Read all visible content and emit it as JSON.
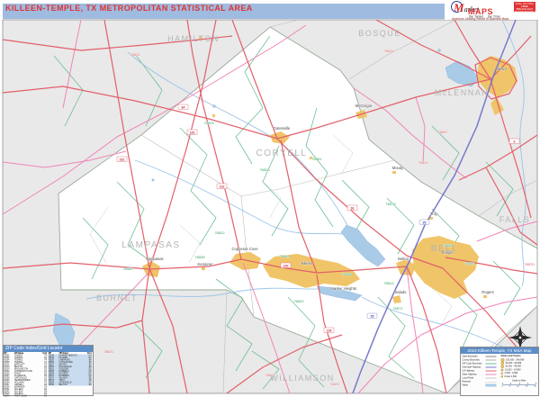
{
  "window": {
    "title": "KILLEEN-TEMPLE, TX METROPOLITAN STATISTICAL AREA"
  },
  "logo": {
    "m": "M",
    "rest": "arket",
    "maps": "MAPS",
    "tagline": "...the Target. ...the Time.",
    "subline": "America's Leading Source of Business Maps",
    "contact1": "CALL US TOLL FREE",
    "contact2": "888-929-4627",
    "contact3": "MARKETMAPS.COM"
  },
  "colors": {
    "header_bar": "#9fbbe0",
    "title_text": "#e03434",
    "outside_msa": "#e9e9e9",
    "inside_msa": "#ffffff",
    "urban_area": "#f0c468",
    "us_highway": "#e2606a",
    "state_highway": "#f084b8",
    "zip_boundary": "#6fbe93",
    "interstate": "#7878cc",
    "water": "#a9cbe8",
    "county_label": "#b5b5b5",
    "panel_header": "#5b8dc8"
  },
  "map": {
    "county_labels": [
      {
        "name": "HAMILTON"
      },
      {
        "name": "BOSQUE"
      },
      {
        "name": "McLENNAN"
      },
      {
        "name": "CORYELL"
      },
      {
        "name": "LAMPASAS"
      },
      {
        "name": "BURNET"
      },
      {
        "name": "BELL"
      },
      {
        "name": "FALLS"
      },
      {
        "name": "WILLIAMSON"
      }
    ],
    "city_labels": [
      {
        "name": "Killeen"
      },
      {
        "name": "Copperas Cove"
      },
      {
        "name": "Harker Heights"
      },
      {
        "name": "Temple"
      },
      {
        "name": "Belton"
      },
      {
        "name": "Gatesville"
      },
      {
        "name": "Lampasas"
      },
      {
        "name": "Waco"
      },
      {
        "name": "Salado"
      },
      {
        "name": "McGregor"
      },
      {
        "name": "Moody"
      },
      {
        "name": "Troy"
      },
      {
        "name": "Rogers"
      },
      {
        "name": "Kempner"
      }
    ],
    "zip_green": [
      "76522",
      "76528",
      "76539",
      "76549",
      "76542",
      "76548",
      "76513",
      "76504",
      "76501",
      "76571",
      "76579",
      "76550",
      "76525",
      "76561"
    ],
    "zip_red": [
      "76531",
      "76634",
      "76657",
      "76524",
      "78605",
      "76527",
      "76537",
      "76570"
    ],
    "shields": [
      {
        "t": "84"
      },
      {
        "t": "281"
      },
      {
        "t": "183"
      },
      {
        "t": "190"
      },
      {
        "t": "36"
      },
      {
        "t": "195"
      },
      {
        "t": "116"
      },
      {
        "t": "6"
      },
      {
        "t": "35"
      },
      {
        "t": "35"
      }
    ]
  },
  "zip_index": {
    "title": "ZIP Code Index/Grid Locator",
    "columns": [
      "ZIP",
      "ZIP Name",
      "Grid"
    ],
    "rows_left": [
      [
        "76501",
        "TEMPLE",
        "F4"
      ],
      [
        "76502",
        "TEMPLE",
        "E4"
      ],
      [
        "76504",
        "TEMPLE",
        "F4"
      ],
      [
        "76508",
        "TEMPLE",
        "F4"
      ],
      [
        "76511",
        "BARTLETT",
        "F6"
      ],
      [
        "76513",
        "BELTON",
        "E4"
      ],
      [
        "76519",
        "BURLINGTON",
        "G5"
      ],
      [
        "76522",
        "COPPERAS COVE",
        "C4"
      ],
      [
        "76525",
        "EVANT",
        "B2"
      ],
      [
        "76527",
        "FLORENCE",
        "D6"
      ],
      [
        "76528",
        "GATESVILLE",
        "C2"
      ],
      [
        "76533",
        "HEIDENHEIMER",
        "F4"
      ],
      [
        "76534",
        "HOLLAND",
        "F5"
      ],
      [
        "76537",
        "JARRELL",
        "E6"
      ],
      [
        "76539",
        "KEMPNER",
        "C4"
      ],
      [
        "76541",
        "KILLEEN",
        "D4"
      ],
      [
        "76542",
        "KILLEEN",
        "D4"
      ],
      [
        "76543",
        "KILLEEN",
        "D4"
      ],
      [
        "76544",
        "FORT HOOD",
        "D4"
      ]
    ],
    "rows_right": [
      [
        "76548",
        "HARKER HEIGHTS",
        "D4"
      ],
      [
        "76549",
        "KILLEEN",
        "D4"
      ],
      [
        "76550",
        "LAMPASAS",
        "B4"
      ],
      [
        "76554",
        "LITTLE RIVER",
        "F5"
      ],
      [
        "76557",
        "MOODY",
        "E3"
      ],
      [
        "76559",
        "NOLANVILLE",
        "E4"
      ],
      [
        "76561",
        "OGLESBY",
        "D2"
      ],
      [
        "76566",
        "PURMELA",
        "C2"
      ],
      [
        "76569",
        "ROGERS",
        "G5"
      ],
      [
        "76570",
        "ROSEBUD",
        "H4"
      ],
      [
        "76571",
        "SALADO",
        "E5"
      ],
      [
        "76579",
        "TROY",
        "F3"
      ],
      [
        "76596",
        "GATESVILLE",
        "C2"
      ],
      [
        "76599",
        "BELTON",
        "E4"
      ]
    ]
  },
  "legend": {
    "title": "2016 Killeen-Temple, TX MSA Map",
    "items": [
      {
        "label": "State Boundary",
        "color": "#8a8a8a",
        "style": "line"
      },
      {
        "label": "County Boundary",
        "color": "#b0b0b0",
        "style": "line"
      },
      {
        "label": "ZIP Code Boundary",
        "color": "#6fbe93",
        "style": "line"
      },
      {
        "label": "Interstate Highway",
        "color": "#7878cc",
        "style": "line"
      },
      {
        "label": "US Highway",
        "color": "#e2606a",
        "style": "line"
      },
      {
        "label": "State Highway",
        "color": "#f084b8",
        "style": "line"
      },
      {
        "label": "Local Road",
        "color": "#c9c9c9",
        "style": "line"
      },
      {
        "label": "Railroad",
        "color": "#9a9a9a",
        "style": "dashed"
      },
      {
        "label": "Water",
        "color": "#a9cbe8",
        "style": "fill"
      }
    ],
    "cities": {
      "title": "Cities and Towns",
      "rows": [
        "100,000 - 249,999",
        "50,000 - 99,999",
        "25,000 - 49,999",
        "10,000 - 24,999",
        "2,500 - 9,999",
        "Under 2,500"
      ]
    },
    "scale": {
      "label": "Scale in Miles",
      "ticks": [
        "0",
        "5",
        "10",
        "15",
        "20"
      ]
    }
  }
}
